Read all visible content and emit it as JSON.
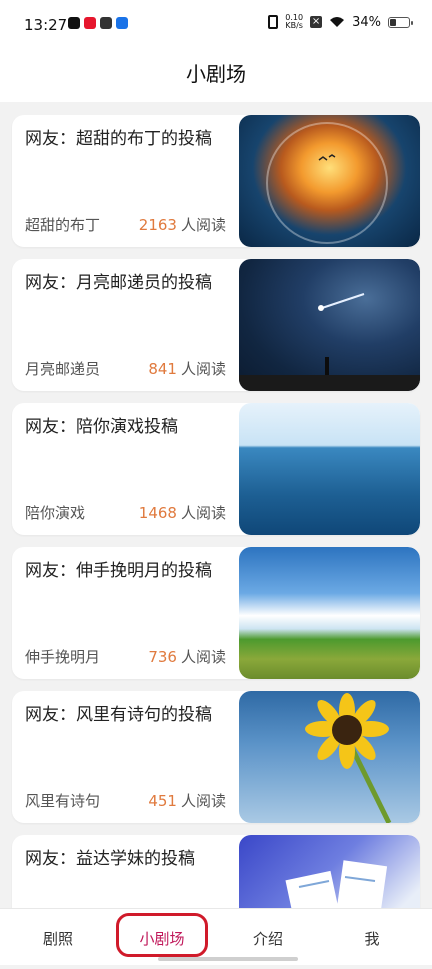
{
  "status_bar": {
    "time": "13:27",
    "net_speed_top": "0.10",
    "net_speed_bottom": "KB/s",
    "battery": "34%",
    "battery_level": 0.34,
    "app_icons": [
      "tiktok-icon",
      "weibo-icon",
      "sync-app-icon",
      "map-app-icon"
    ]
  },
  "header": {
    "title": "小剧场"
  },
  "cards": [
    {
      "title": "网友：超甜的布丁的投稿",
      "author": "超甜的布丁",
      "reads": "2163",
      "reads_suffix": "人阅读",
      "image": "sunset-sphere-image"
    },
    {
      "title": "网友：月亮邮递员的投稿",
      "author": "月亮邮递员",
      "reads": "841",
      "reads_suffix": "人阅读",
      "image": "night-meteor-image"
    },
    {
      "title": "网友：陪你演戏投稿",
      "author": "陪你演戏",
      "reads": "1468",
      "reads_suffix": "人阅读",
      "image": "ocean-image"
    },
    {
      "title": "网友：伸手挽明月的投稿",
      "author": "伸手挽明月",
      "reads": "736",
      "reads_suffix": "人阅读",
      "image": "grassland-clouds-image"
    },
    {
      "title": "网友：风里有诗句的投稿",
      "author": "风里有诗句",
      "reads": "451",
      "reads_suffix": "人阅读",
      "image": "sunflower-image"
    },
    {
      "title": "网友：益达学妹的投稿",
      "author": "",
      "reads": "",
      "reads_suffix": "",
      "image": "paper-illustration-image"
    }
  ],
  "tabs": [
    {
      "label": "剧照",
      "active": false
    },
    {
      "label": "小剧场",
      "active": true
    },
    {
      "label": "介绍",
      "active": false
    },
    {
      "label": "我",
      "active": false
    }
  ],
  "colors": {
    "accent_active_tab": "#c0185a",
    "read_count": "#e07a3e",
    "highlight_box": "#d01a2a"
  }
}
